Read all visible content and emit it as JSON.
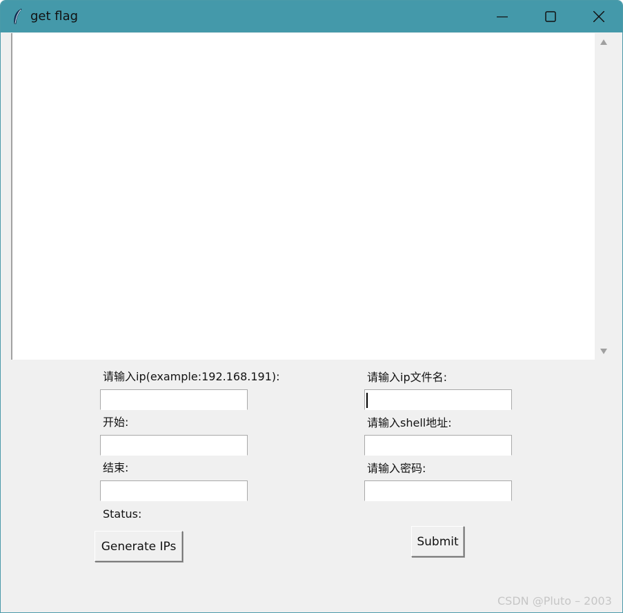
{
  "window": {
    "title": "get flag",
    "icon": "feather-icon",
    "controls": [
      "minimize-icon",
      "maximize-icon",
      "close-icon"
    ]
  },
  "output_text": "",
  "left_form": {
    "ip_label": "请输入ip(example:192.168.191):",
    "ip_value": "",
    "start_label": "开始:",
    "start_value": "",
    "end_label": "结束:",
    "end_value": "",
    "status_label": "Status:",
    "generate_button": "Generate IPs"
  },
  "right_form": {
    "ip_file_label": "请输入ip文件名:",
    "ip_file_value": "",
    "shell_label": "请输入shell地址:",
    "shell_value": "",
    "password_label": "请输入密码:",
    "password_value": "",
    "submit_button": "Submit"
  },
  "watermark": "CSDN @Pluto – 2003",
  "colors": {
    "titlebar": "#4499aa",
    "window_bg": "#f0f0f0"
  }
}
